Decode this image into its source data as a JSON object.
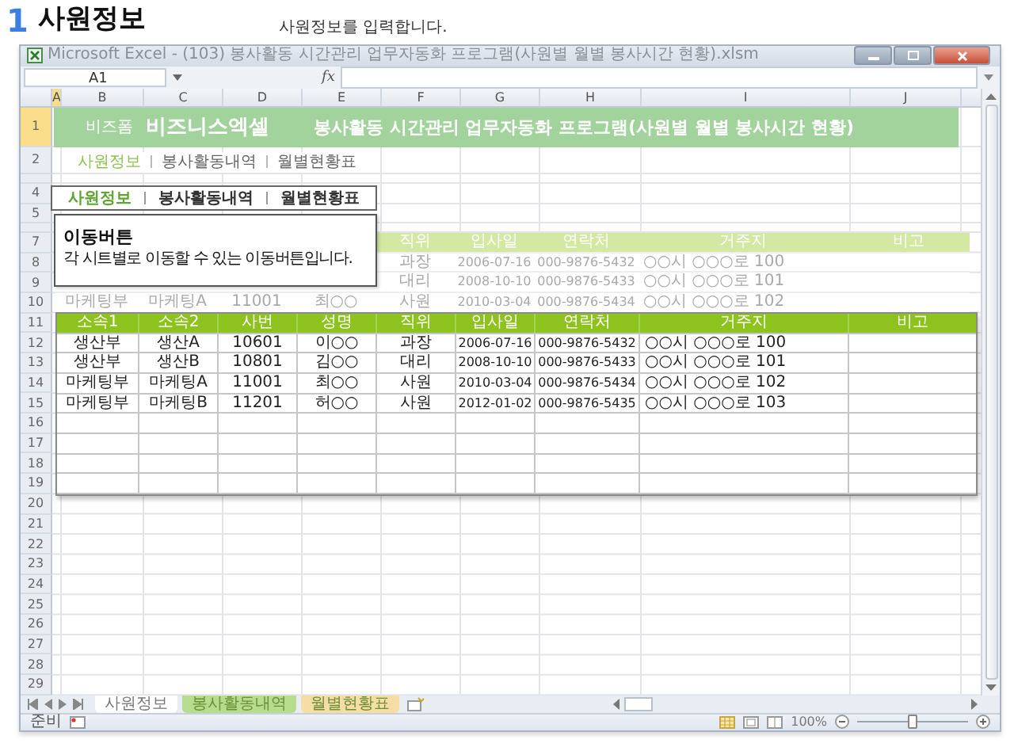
{
  "heading": {
    "number": "1",
    "title": "사원정보"
  },
  "description": "사원정보를 입력합니다.",
  "window": {
    "title": "Microsoft Excel - (103) 봉사활동 시간관리 업무자동화 프로그램(사원별 월별 봉사시간 현황).xlsm"
  },
  "formula_bar": {
    "name_box": "A1",
    "function_label": "fx"
  },
  "columns": [
    "A",
    "B",
    "C",
    "D",
    "E",
    "F",
    "G",
    "H",
    "I",
    "J"
  ],
  "rows": [
    "1",
    "2",
    "4",
    "5",
    "7",
    "8",
    "9",
    "10",
    "11",
    "12",
    "13",
    "14",
    "15",
    "16",
    "17",
    "18",
    "19",
    "20",
    "21",
    "22",
    "23",
    "24",
    "25",
    "26",
    "27",
    "28",
    "29"
  ],
  "banner": {
    "brand_small": "비즈폼",
    "brand": "비즈니스엑셀",
    "title": "봉사활동 시간관리 업무자동화 프로그램(사원별 월별 봉사시간 현황)"
  },
  "nav": [
    {
      "label": "사원정보",
      "selected": true
    },
    {
      "label": "봉사활동내역",
      "selected": false
    },
    {
      "label": "월별현황표",
      "selected": false
    }
  ],
  "nav_zoomed": [
    {
      "label": "사원정보",
      "selected": true
    },
    {
      "label": "봉사활동내역",
      "selected": false
    },
    {
      "label": "월별현황표",
      "selected": false
    }
  ],
  "callout": {
    "title": "이동버튼",
    "text": "각 시트별로 이동할 수 있는 이동버튼입니다."
  },
  "faded_table": {
    "columns": [
      "",
      "",
      "",
      "",
      "직위",
      "입사일",
      "연락처",
      "거주지",
      "비고"
    ],
    "rows": [
      [
        "",
        "",
        "",
        "",
        "과장",
        "2006-07-16",
        "000-9876-5432",
        "○○시 ○○○로 100"
      ],
      [
        "",
        "",
        "",
        "",
        "대리",
        "2008-10-10",
        "000-9876-5433",
        "○○시 ○○○로 101"
      ],
      [
        "마케팅부",
        "마케팅A",
        "11001",
        "최○○",
        "사원",
        "2010-03-04",
        "000-9876-5434",
        "○○시 ○○○로 102"
      ]
    ]
  },
  "table": {
    "columns": [
      "소속1",
      "소속2",
      "사번",
      "성명",
      "직위",
      "입사일",
      "연락처",
      "거주지",
      "비고"
    ],
    "rows": [
      [
        "생산부",
        "생산A",
        "10601",
        "이○○",
        "과장",
        "2006-07-16",
        "000-9876-5432",
        "○○시 ○○○로 100"
      ],
      [
        "생산부",
        "생산B",
        "10801",
        "김○○",
        "대리",
        "2008-10-10",
        "000-9876-5433",
        "○○시 ○○○로 101"
      ],
      [
        "마케팅부",
        "마케팅A",
        "11001",
        "최○○",
        "사원",
        "2010-03-04",
        "000-9876-5434",
        "○○시 ○○○로 102"
      ],
      [
        "마케팅부",
        "마케팅B",
        "11201",
        "허○○",
        "사원",
        "2012-01-02",
        "000-9876-5435",
        "○○시 ○○○로 103"
      ]
    ]
  },
  "sheet_tabs": [
    {
      "label": "사원정보",
      "selected": true
    },
    {
      "label": "봉사활동내역",
      "selected": false,
      "color": "#b7dc8e"
    },
    {
      "label": "월별현황표",
      "selected": false,
      "color": "#f6dda6"
    }
  ],
  "status_bar": {
    "text": "준비",
    "zoom": "100%",
    "zoom_slider": {
      "level": 0.5
    }
  }
}
